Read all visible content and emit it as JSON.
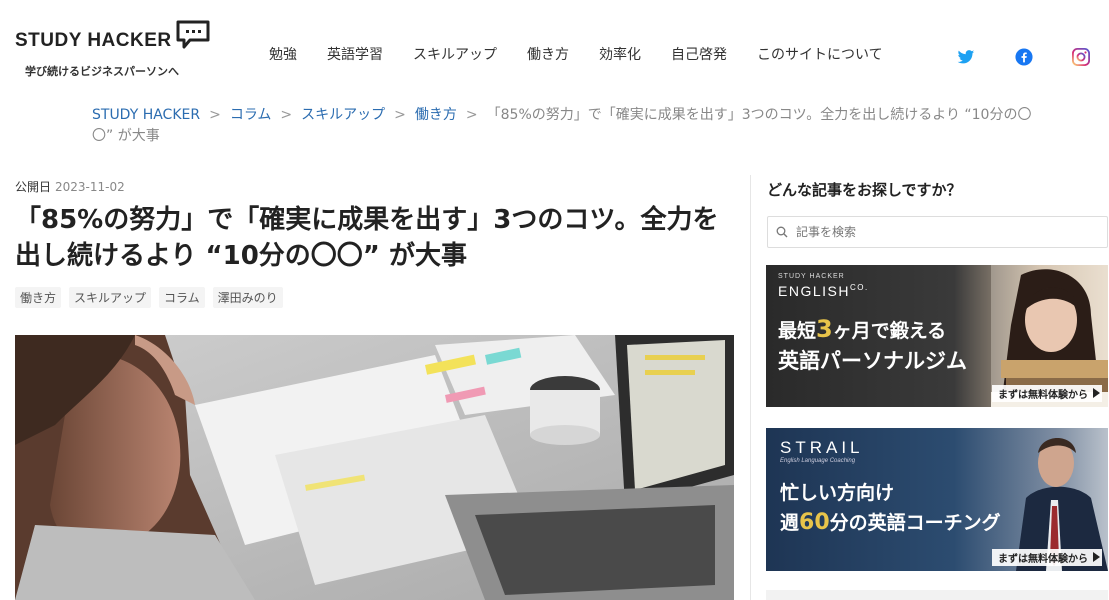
{
  "header": {
    "logo_text": "STUDY HACKER",
    "tagline": "学び続けるビジネスパーソンへ",
    "nav": [
      "勉強",
      "英語学習",
      "スキルアップ",
      "働き方",
      "効率化",
      "自己啓発",
      "このサイトについて"
    ],
    "social": [
      "twitter-icon",
      "facebook-icon",
      "instagram-icon"
    ],
    "colors": {
      "twitter": "#1da1f2",
      "facebook": "#1877f2",
      "instagram": "#e1306c",
      "link": "#2b6cb0"
    }
  },
  "breadcrumb": {
    "items": [
      "STUDY HACKER",
      "コラム",
      "スキルアップ",
      "働き方"
    ],
    "separator": ">",
    "current": "「85%の努力」で「確実に成果を出す」3つのコツ。全力を出し続けるより “10分の〇〇” が大事"
  },
  "article": {
    "published_label": "公開日",
    "published_date": "2023-11-02",
    "title": "「85%の努力」で「確実に成果を出す」3つのコツ。全力を出し続けるより “10分の〇〇” が大事",
    "tags": [
      "働き方",
      "スキルアップ",
      "コラム",
      "澤田みのり"
    ]
  },
  "sidebar": {
    "heading": "どんな記事をお探しですか？",
    "search_placeholder": "記事を検索",
    "banner1": {
      "brand_small": "STUDY HACKER",
      "brand_large": "ENGLISH",
      "brand_suffix": "CO.",
      "line1_prefix": "最短",
      "line1_emphasis": "3",
      "line1_suffix": "ヶ月で鍛える",
      "line2": "英語パーソナルジム",
      "cta": "まずは無料体験から"
    },
    "banner2": {
      "brand": "STRAIL",
      "sub": "English Language Coaching",
      "line1": "忙しい方向け",
      "line2_prefix": "週",
      "line2_emphasis": "60",
      "line2_suffix": "分の英語コーチング",
      "cta": "まずは無料体験から"
    }
  }
}
